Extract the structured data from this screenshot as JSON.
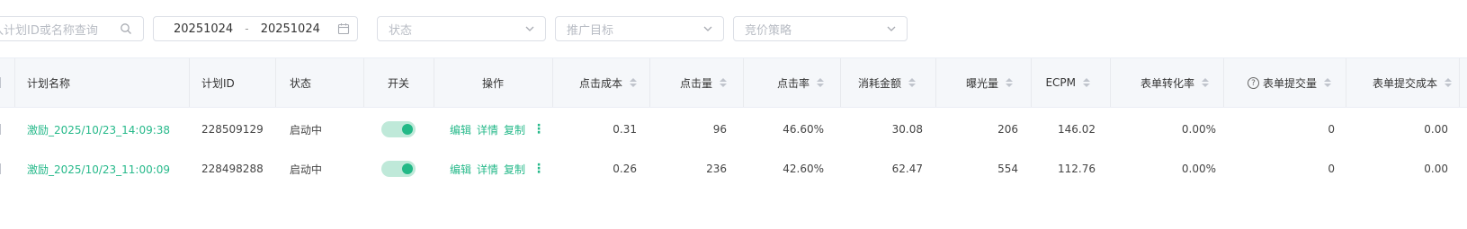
{
  "filters": {
    "search_placeholder": "入计划ID或名称查询",
    "date_start": "20251024",
    "date_sep": "-",
    "date_end": "20251024",
    "status_placeholder": "状态",
    "target_placeholder": "推广目标",
    "bid_placeholder": "竞价策略"
  },
  "columns": {
    "name": "计划名称",
    "id": "计划ID",
    "status": "状态",
    "switch": "开关",
    "ops": "操作",
    "cpc": "点击成本",
    "clicks": "点击量",
    "ctr": "点击率",
    "cost": "消耗金额",
    "impr": "曝光量",
    "ecpm": "ECPM",
    "form_cvr": "表单转化率",
    "form_submits": "表单提交量",
    "form_cost": "表单提交成本"
  },
  "ops_labels": {
    "edit": "编辑",
    "detail": "详情",
    "copy": "复制",
    "more": "⋮"
  },
  "rows": [
    {
      "name": "激励_2025/10/23_14:09:38",
      "id": "228509129",
      "status": "启动中",
      "switch_on": true,
      "cpc": "0.31",
      "clicks": "96",
      "ctr": "46.60%",
      "cost": "30.08",
      "impr": "206",
      "ecpm": "146.02",
      "form_cvr": "0.00%",
      "form_submits": "0",
      "form_cost": "0.00"
    },
    {
      "name": "激励_2025/10/23_11:00:09",
      "id": "228498288",
      "status": "启动中",
      "switch_on": true,
      "cpc": "0.26",
      "clicks": "236",
      "ctr": "42.60%",
      "cost": "62.47",
      "impr": "554",
      "ecpm": "112.76",
      "form_cvr": "0.00%",
      "form_submits": "0",
      "form_cost": "0.00"
    }
  ],
  "colors": {
    "accent": "#26b98a",
    "toggle_track": "#bfe9d9",
    "header_bg": "#f5f7fa"
  }
}
